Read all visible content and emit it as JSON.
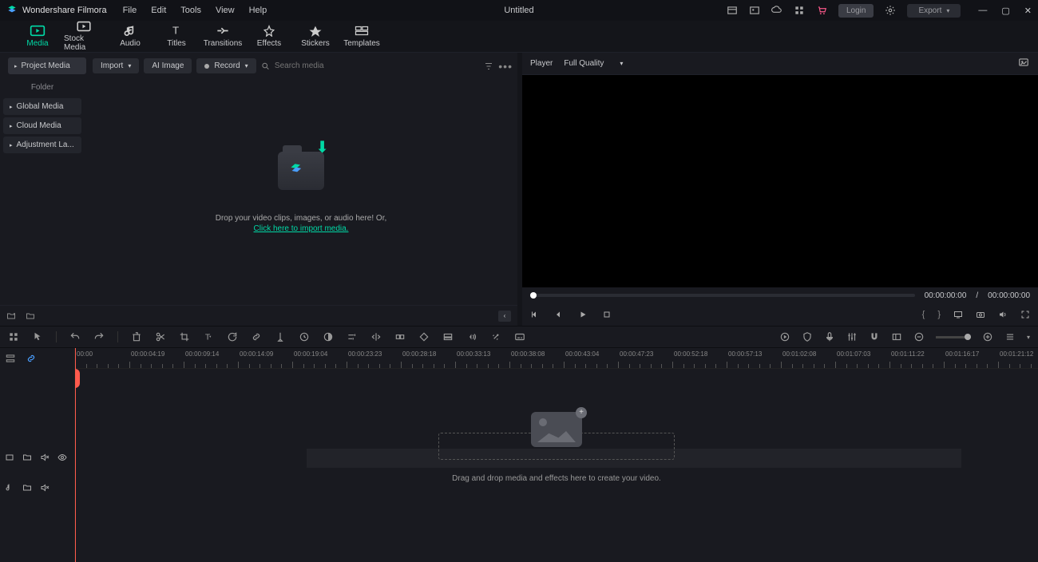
{
  "app": {
    "name": "Wondershare Filmora",
    "title": "Untitled"
  },
  "menu": {
    "file": "File",
    "edit": "Edit",
    "tools": "Tools",
    "view": "View",
    "help": "Help"
  },
  "titlebar": {
    "login": "Login",
    "export": "Export"
  },
  "ribbon": {
    "media": "Media",
    "stock": "Stock Media",
    "audio": "Audio",
    "titles": "Titles",
    "transitions": "Transitions",
    "effects": "Effects",
    "stickers": "Stickers",
    "templates": "Templates"
  },
  "sidebar": {
    "project": "Project Media",
    "folder": "Folder",
    "global": "Global Media",
    "cloud": "Cloud Media",
    "adjust": "Adjustment La..."
  },
  "mediabar": {
    "import": "Import",
    "aiimage": "AI Image",
    "record": "Record",
    "search_ph": "Search media"
  },
  "drop": {
    "text": "Drop your video clips, images, or audio here! Or,",
    "link": "Click here to import media."
  },
  "player": {
    "label": "Player",
    "quality": "Full Quality",
    "cur": "00:00:00:00",
    "sep": "/",
    "dur": "00:00:00:00"
  },
  "ruler": [
    "00:00",
    "00:00:04:19",
    "00:00:09:14",
    "00:00:14:09",
    "00:00:19:04",
    "00:00:23:23",
    "00:00:28:18",
    "00:00:33:13",
    "00:00:38:08",
    "00:00:43:04",
    "00:00:47:23",
    "00:00:52:18",
    "00:00:57:13",
    "00:01:02:08",
    "00:01:07:03",
    "00:01:11:22",
    "00:01:16:17",
    "00:01:21:12"
  ],
  "timeline": {
    "hint": "Drag and drop media and effects here to create your video."
  }
}
